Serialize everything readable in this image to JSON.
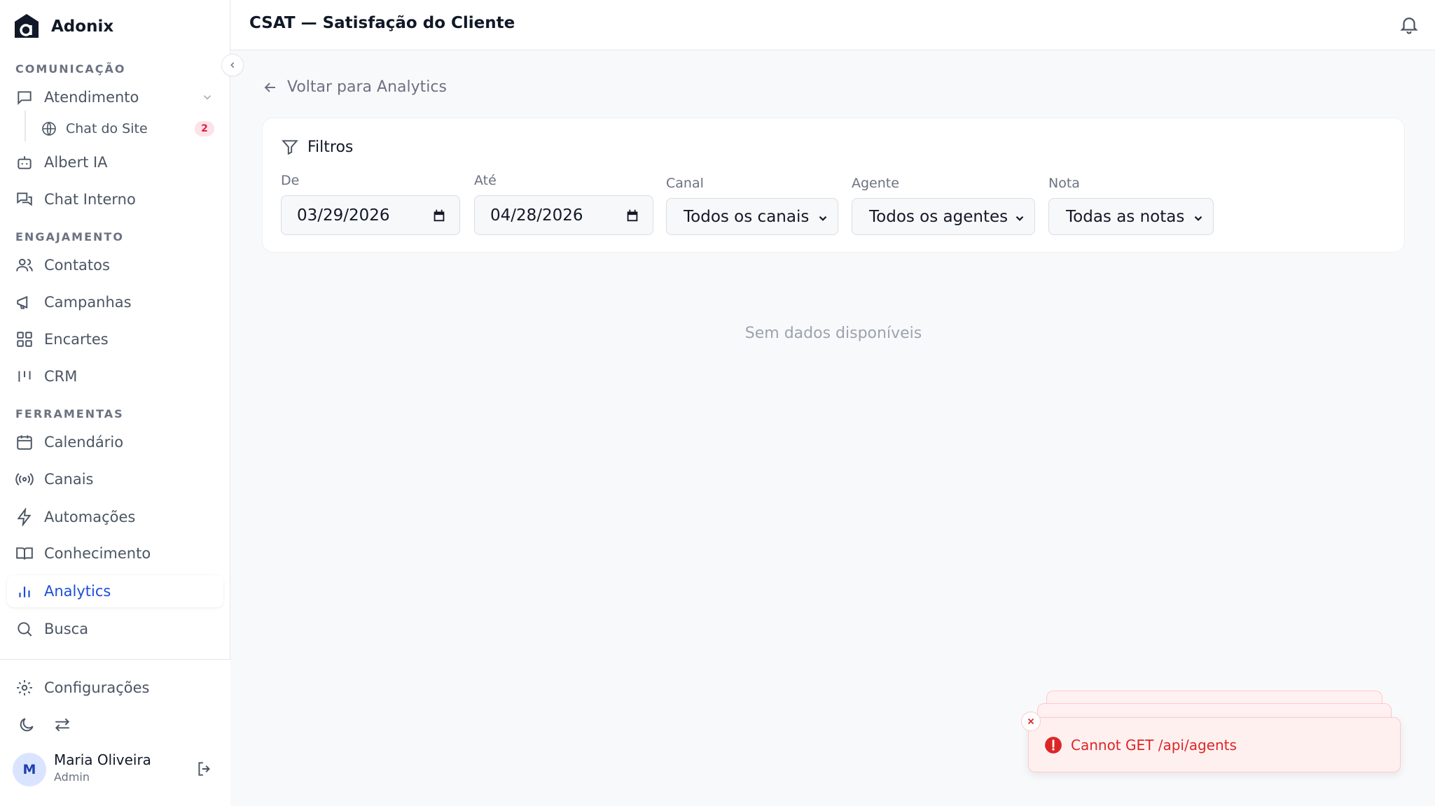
{
  "brand": {
    "name": "Adonix"
  },
  "header": {
    "title": "CSAT — Satisfação do Cliente"
  },
  "sidebar": {
    "sections": [
      {
        "title": "COMUNICAÇÃO"
      },
      {
        "title": "ENGAJAMENTO"
      },
      {
        "title": "FERRAMENTAS"
      }
    ],
    "items": {
      "atendimento": "Atendimento",
      "chat_site": "Chat do Site",
      "chat_site_badge": "2",
      "albert": "Albert IA",
      "chat_interno": "Chat Interno",
      "contatos": "Contatos",
      "campanhas": "Campanhas",
      "encartes": "Encartes",
      "crm": "CRM",
      "calendario": "Calendário",
      "canais": "Canais",
      "automacoes": "Automações",
      "conhecimento": "Conhecimento",
      "analytics": "Analytics",
      "busca": "Busca",
      "configuracoes": "Configurações"
    },
    "user": {
      "initial": "M",
      "name": "Maria Oliveira",
      "role": "Admin"
    }
  },
  "main": {
    "back_label": "Voltar para Analytics",
    "filters": {
      "title": "Filtros",
      "from_label": "De",
      "from_value": "03/29/2026",
      "to_label": "Até",
      "to_value": "04/28/2026",
      "channel_label": "Canal",
      "channel_value": "Todos os canais",
      "agent_label": "Agente",
      "agent_value": "Todos os agentes",
      "rating_label": "Nota",
      "rating_value": "Todas as notas"
    },
    "empty_text": "Sem dados disponíveis"
  },
  "toast": {
    "message": "Cannot GET /api/agents"
  },
  "colors": {
    "accent": "#1d4ed8",
    "error": "#dc2626",
    "badge": "#e11d48"
  }
}
